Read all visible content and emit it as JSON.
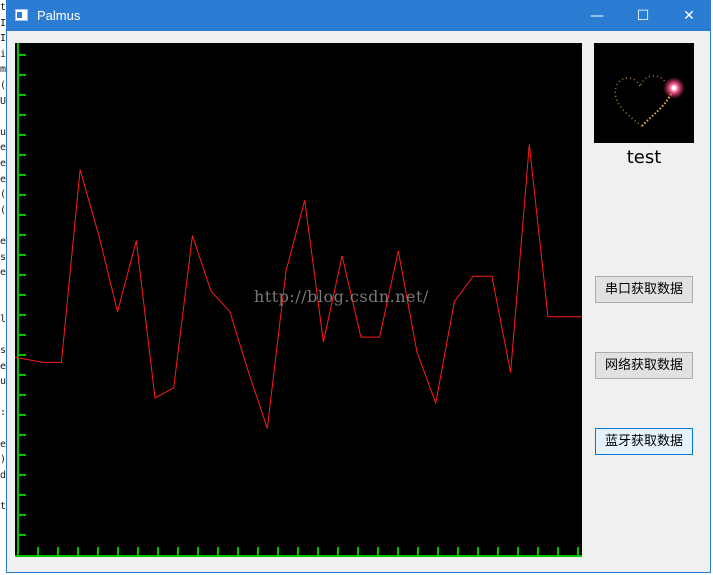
{
  "window": {
    "title": "Palmus"
  },
  "titlebar": {
    "minimize_glyph": "—",
    "maximize_glyph": "☐",
    "close_glyph": "✕"
  },
  "side": {
    "status_label": "test",
    "buttons": [
      "串口获取数据",
      "网络获取数据",
      "蓝牙获取数据"
    ]
  },
  "watermark": "http://blog.csdn.net/",
  "background_code_chars": [
    "t",
    "I",
    "I",
    "i",
    "m",
    "(",
    "U",
    "",
    "u",
    "e",
    "e",
    "e",
    "(",
    "(",
    "",
    "e",
    "s",
    "e",
    "",
    "",
    "l",
    "",
    "s",
    "e",
    "u",
    "",
    ":",
    "",
    "e",
    ")",
    "d",
    "",
    "t"
  ],
  "colors": {
    "trace": "#ff1a1a",
    "axis": "#00c000",
    "plot_bg": "#000000",
    "accent": "#0078d7"
  },
  "chart_data": {
    "type": "line",
    "title": "",
    "xlabel": "",
    "ylabel": "",
    "x": [
      0,
      1,
      2,
      3,
      4,
      5,
      6,
      7,
      8,
      9,
      10,
      11,
      12,
      13,
      14,
      15,
      16,
      17,
      18,
      19,
      20,
      21,
      22,
      23,
      24,
      25,
      26,
      27,
      28
    ],
    "series": [
      {
        "values": [
          0.38,
          0.37,
          0.37,
          0.75,
          0.62,
          0.47,
          0.61,
          0.3,
          0.32,
          0.62,
          0.51,
          0.47,
          0.35,
          0.24,
          0.55,
          0.69,
          0.41,
          0.58,
          0.42,
          0.42,
          0.59,
          0.39,
          0.29,
          0.49,
          0.54,
          0.54,
          0.35,
          0.8,
          0.46
        ]
      },
      {
        "values": [
          0.46
        ]
      }
    ],
    "ylim": [
      0,
      1
    ],
    "grid": false
  }
}
